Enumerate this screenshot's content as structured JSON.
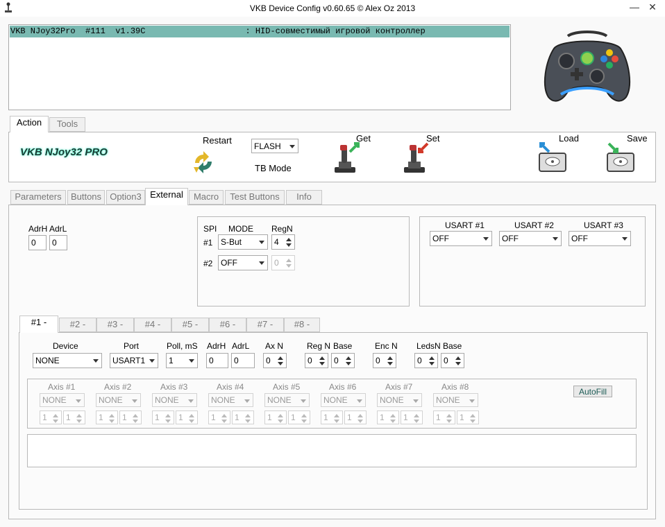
{
  "window": {
    "title": "VKB Device Config v0.60.65 © Alex Oz 2013",
    "minimize": "—",
    "close": "✕"
  },
  "device_list": {
    "row": "VKB NJoy32Pro  #111  v1.39C                    : HID-совместимый игровой контроллер"
  },
  "top_tabs": [
    {
      "label": "Action"
    },
    {
      "label": "Tools"
    }
  ],
  "action": {
    "brand": "VKB NJoy32 PRO",
    "restart": "Restart",
    "flash_value": "FLASH",
    "tb_mode": "TB Mode",
    "get": "Get",
    "set": "Set",
    "load": "Load",
    "save": "Save"
  },
  "main_tabs": [
    {
      "label": "Parameters"
    },
    {
      "label": "Buttons"
    },
    {
      "label": "Option3"
    },
    {
      "label": "External"
    },
    {
      "label": "Macro"
    },
    {
      "label": "Test Buttons"
    },
    {
      "label": "Info"
    }
  ],
  "external": {
    "adrh_label": "AdrH",
    "adrl_label": "AdrL",
    "adrh": "0",
    "adrl": "0",
    "spi": {
      "spi_label": "SPI",
      "mode_label": "MODE",
      "regn_label": "RegN",
      "row1_label": "#1",
      "row1_mode": "S-But",
      "row1_regn": "4",
      "row2_label": "#2",
      "row2_mode": "OFF",
      "row2_regn": "0"
    },
    "usart": [
      {
        "label": "USART #1",
        "value": "OFF"
      },
      {
        "label": "USART #2",
        "value": "OFF"
      },
      {
        "label": "USART #3",
        "value": "OFF"
      }
    ]
  },
  "sub_tabs": [
    {
      "label": "#1 -"
    },
    {
      "label": "#2 -"
    },
    {
      "label": "#3 -"
    },
    {
      "label": "#4 -"
    },
    {
      "label": "#5 -"
    },
    {
      "label": "#6 -"
    },
    {
      "label": "#7 -"
    },
    {
      "label": "#8 -"
    }
  ],
  "device_cfg": {
    "device_label": "Device",
    "device_value": "NONE",
    "port_label": "Port",
    "port_value": "USART1",
    "poll_label": "Poll, mS",
    "poll_value": "1",
    "adrh_label": "AdrH",
    "adrh_value": "0",
    "adrl_label": "AdrL",
    "adrl_value": "0",
    "axn_label": "Ax N",
    "axn_value": "0",
    "regn_label": "Reg N",
    "regn_value": "0",
    "base_label": "Base",
    "base_value": "0",
    "encn_label": "Enc N",
    "encn_value": "0",
    "ledsn_label": "LedsN",
    "ledsn_value": "0",
    "base2_label": "Base",
    "base2_value": "0"
  },
  "axes": [
    {
      "label": "Axis #1",
      "mode": "NONE",
      "a": "1",
      "b": "1"
    },
    {
      "label": "Axis #2",
      "mode": "NONE",
      "a": "1",
      "b": "1"
    },
    {
      "label": "Axis #3",
      "mode": "NONE",
      "a": "1",
      "b": "1"
    },
    {
      "label": "Axis #4",
      "mode": "NONE",
      "a": "1",
      "b": "1"
    },
    {
      "label": "Axis #5",
      "mode": "NONE",
      "a": "1",
      "b": "1"
    },
    {
      "label": "Axis #6",
      "mode": "NONE",
      "a": "1",
      "b": "1"
    },
    {
      "label": "Axis #7",
      "mode": "NONE",
      "a": "1",
      "b": "1"
    },
    {
      "label": "Axis #8",
      "mode": "NONE",
      "a": "1",
      "b": "1"
    }
  ],
  "autofill": "AutoFill",
  "colors": {
    "selection": "#79b9b1",
    "brand_text": "#1d3b36",
    "arrow_green": "#3bb35a",
    "arrow_red": "#d23a2a",
    "arrow_blue": "#2a8fd6"
  }
}
